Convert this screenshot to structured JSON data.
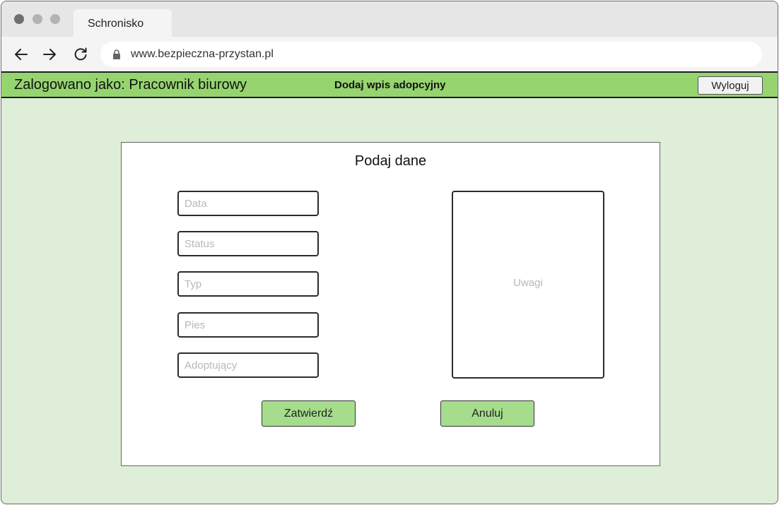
{
  "browser": {
    "tab_title": "Schronisko",
    "url": "www.bezpieczna-przystan.pl"
  },
  "header": {
    "logged_in_as": "Zalogowano jako: Pracownik biurowy",
    "page_title": "Dodaj wpis adopcyjny",
    "logout_label": "Wyloguj"
  },
  "form": {
    "title": "Podaj dane",
    "fields": [
      {
        "placeholder": "Data",
        "value": ""
      },
      {
        "placeholder": "Status",
        "value": ""
      },
      {
        "placeholder": "Typ",
        "value": ""
      },
      {
        "placeholder": "Pies",
        "value": ""
      },
      {
        "placeholder": "Adoptujący",
        "value": ""
      }
    ],
    "notes_placeholder": "Uwagi",
    "confirm_label": "Zatwierdź",
    "cancel_label": "Anuluj"
  },
  "colors": {
    "header_bg": "#96d470",
    "page_bg": "#dfeed8",
    "button_bg": "#a6dd8c"
  },
  "icons": [
    "back-arrow-icon",
    "forward-arrow-icon",
    "reload-icon",
    "lock-icon"
  ]
}
